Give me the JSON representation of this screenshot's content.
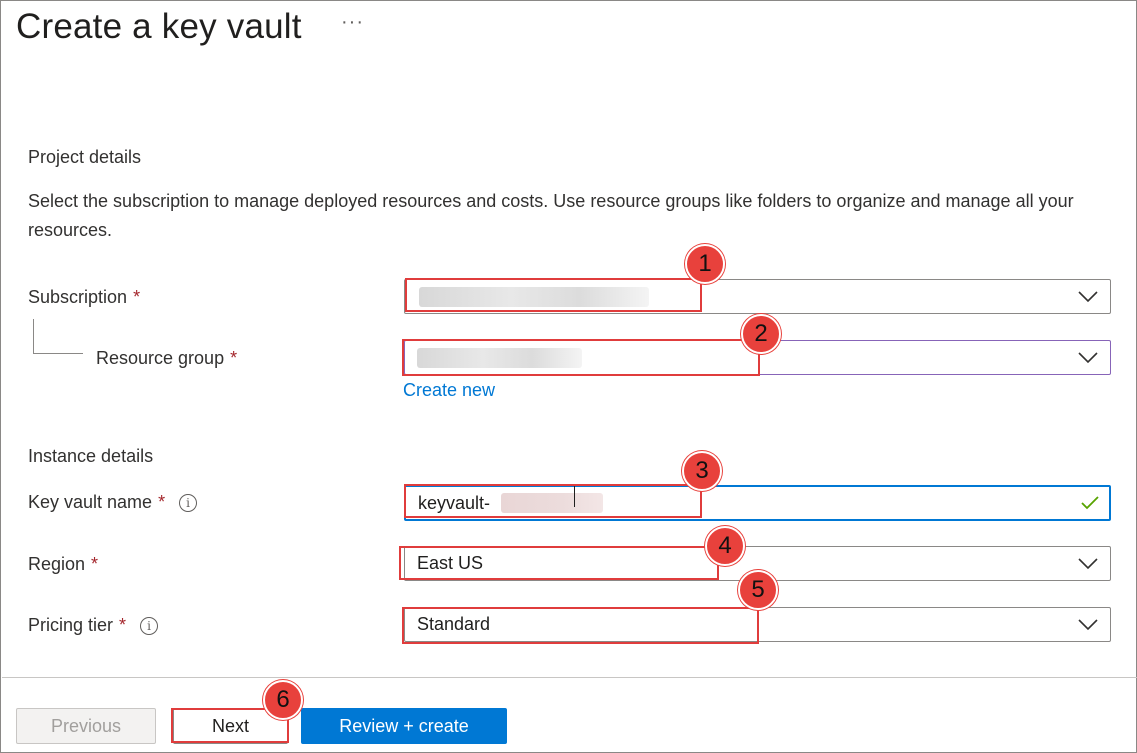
{
  "page": {
    "title": "Create a key vault",
    "more_glyph": "···"
  },
  "project": {
    "heading": "Project details",
    "description": "Select the subscription to manage deployed resources and costs. Use resource groups like folders to organize and manage all your resources."
  },
  "subscription": {
    "label": "Subscription",
    "required": "*",
    "value_redacted": true
  },
  "resource_group": {
    "label": "Resource group",
    "required": "*",
    "value_redacted": true,
    "create_new": "Create new"
  },
  "instance": {
    "heading": "Instance details"
  },
  "key_vault_name": {
    "label": "Key vault name",
    "required": "*",
    "info_glyph": "i",
    "value": "keyvault-",
    "valid": true
  },
  "region": {
    "label": "Region",
    "required": "*",
    "value": "East US"
  },
  "pricing_tier": {
    "label": "Pricing tier",
    "required": "*",
    "info_glyph": "i",
    "value": "Standard"
  },
  "footer": {
    "previous": "Previous",
    "next": "Next",
    "review_create": "Review + create"
  },
  "annotations": [
    "1",
    "2",
    "3",
    "4",
    "5",
    "6"
  ],
  "colors": {
    "accent": "#0078d4",
    "required": "#a4262c",
    "valid_check": "#57a300",
    "annotation": "#e8413c"
  }
}
